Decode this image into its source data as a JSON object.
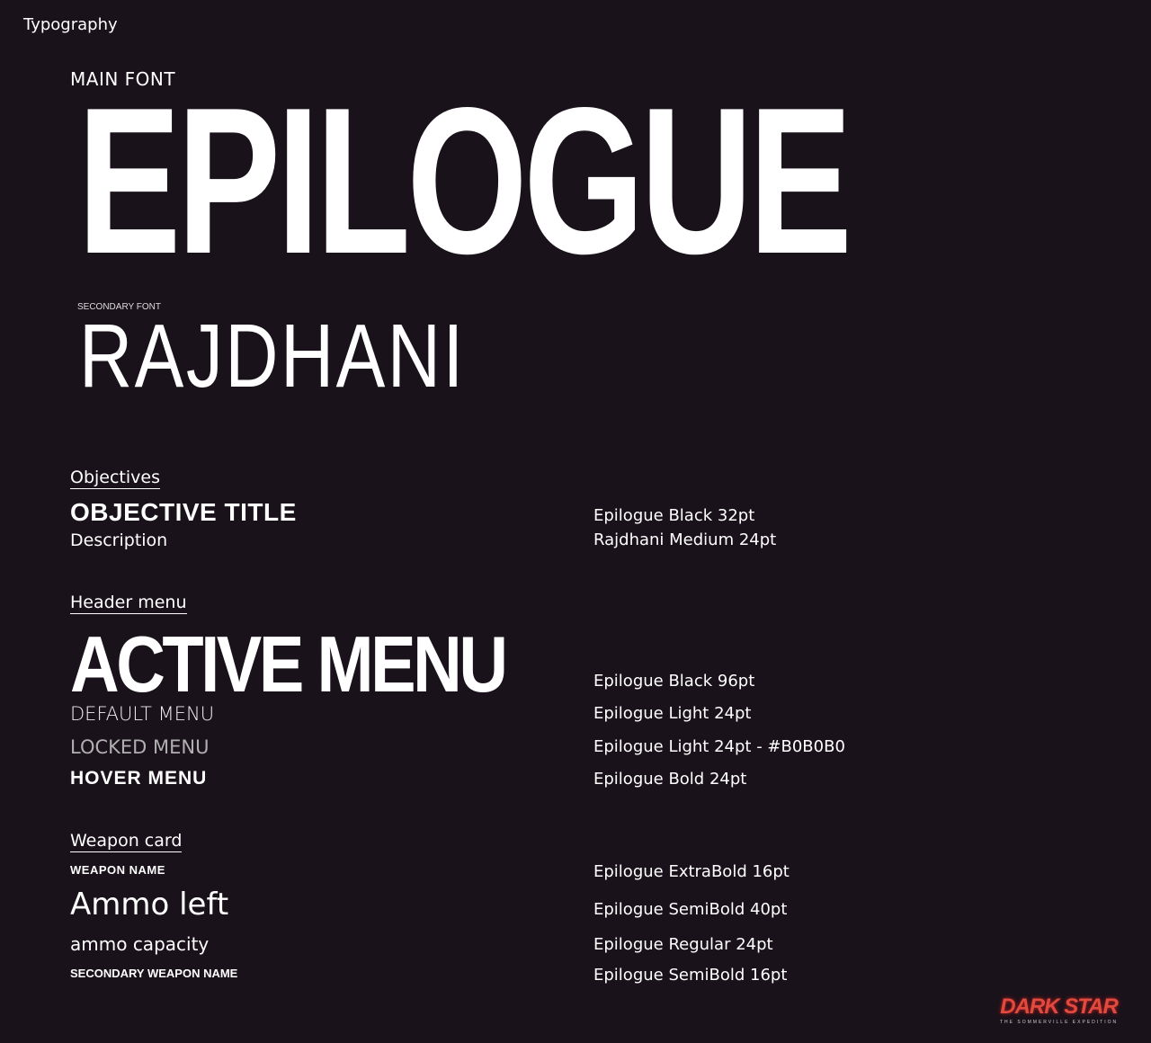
{
  "page_title": "Typography",
  "main_font": {
    "label": "MAIN FONT",
    "name": "EPILOGUE"
  },
  "secondary_font": {
    "label": "SECONDARY FONT",
    "name": "RAJDHANI"
  },
  "sections": {
    "objectives": {
      "heading": "Objectives",
      "samples": [
        {
          "text": "OBJECTIVE TITLE",
          "spec": "Epilogue Black 32pt"
        },
        {
          "text": "Description",
          "spec": "Rajdhani Medium 24pt"
        }
      ]
    },
    "header_menu": {
      "heading": "Header menu",
      "samples": [
        {
          "text": "ACTIVE MENU",
          "spec": "Epilogue Black 96pt"
        },
        {
          "text": "DEFAULT MENU",
          "spec": "Epilogue Light 24pt"
        },
        {
          "text": "LOCKED MENU",
          "spec": "Epilogue Light 24pt - #B0B0B0"
        },
        {
          "text": "HOVER MENU",
          "spec": "Epilogue Bold 24pt"
        }
      ]
    },
    "weapon_card": {
      "heading": "Weapon card",
      "samples": [
        {
          "text": "WEAPON NAME",
          "spec": "Epilogue ExtraBold 16pt"
        },
        {
          "text": "Ammo left",
          "spec": "Epilogue SemiBold 40pt"
        },
        {
          "text": "ammo capacity",
          "spec": "Epilogue Regular 24pt"
        },
        {
          "text": "SECONDARY WEAPON NAME",
          "spec": "Epilogue SemiBold 16pt"
        }
      ]
    }
  },
  "colors": {
    "background": "#1a121a",
    "locked": "#B0B0B0",
    "logo": "#e04a3f"
  },
  "logo": {
    "name": "DARK STAR",
    "tagline": "THE SOMMERVILLE EXPEDITION"
  }
}
